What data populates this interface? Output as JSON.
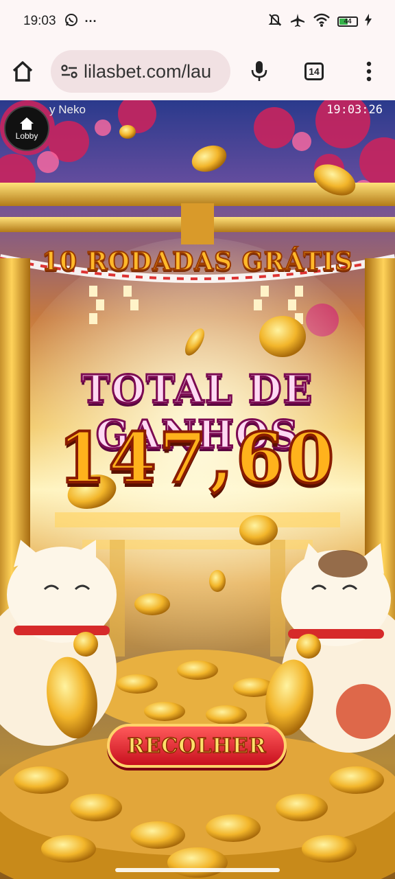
{
  "status_bar": {
    "time": "19:03",
    "more": "···",
    "battery_level": "44",
    "icons": [
      "whatsapp-icon",
      "mute-icon",
      "airplane-icon",
      "wifi-icon",
      "battery-icon",
      "charging-icon"
    ]
  },
  "browser": {
    "url": "lilasbet.com/lau",
    "tab_count": "14",
    "icons": [
      "home-icon",
      "site-settings-icon",
      "mic-icon",
      "menu-icon"
    ]
  },
  "game": {
    "lobby_label": "Lobby",
    "title": "y Neko",
    "clock": "19:03:26",
    "free_spins_text": "10 RODADAS GRÁTIS",
    "total_title": "TOTAL DE GANHOS",
    "total_amount": "147,60",
    "collect_label": "RECOLHER"
  },
  "colors": {
    "accent_gold": "#ffb21c",
    "button_red": "#d81f2a",
    "title_pink": "#ffd9f3"
  }
}
